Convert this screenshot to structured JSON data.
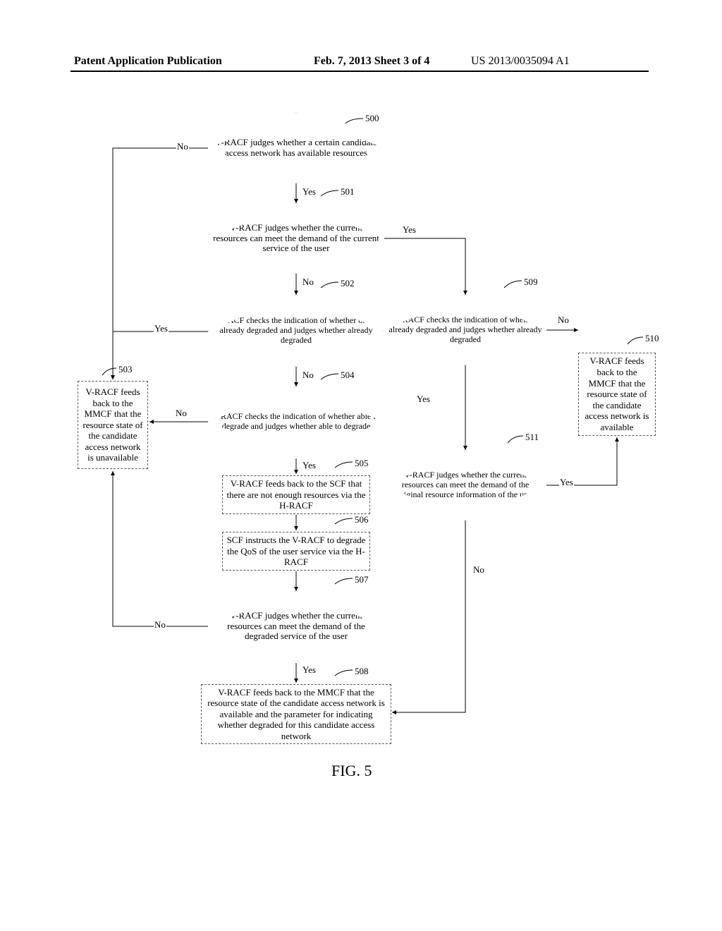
{
  "header": {
    "left": "Patent Application Publication",
    "center": "Feb. 7, 2013  Sheet 3 of 4",
    "right": "US 2013/0035094 A1"
  },
  "figure_caption": "FIG. 5",
  "refs": {
    "r500": "500",
    "r501": "501",
    "r502": "502",
    "r503": "503",
    "r504": "504",
    "r505": "505",
    "r506": "506",
    "r507": "507",
    "r508": "508",
    "r509": "509",
    "r510": "510",
    "r511": "511"
  },
  "labels": {
    "yes": "Yes",
    "no": "No"
  },
  "nodes": {
    "d500": "V-RACF judges whether a certain candidate access network has available resources",
    "d501": "V-RACF judges whether the current resources can meet the demand of the current service of the user",
    "d502": "V-RACF checks the indication of whether or not already degraded and judges whether already degraded",
    "b503": "V-RACF feeds back to the MMCF that the resource state of the candidate access network is unavailable",
    "d504": "V-RACF checks the indication of whether able to degrade and judges whether able to degrade",
    "b505": "V-RACF feeds back to the SCF that there are not enough resources via the H-RACF",
    "b506": "SCF instructs the V-RACF to degrade the QoS of the user service via the H-RACF",
    "d507": "V-RACF judges whether the current resources can meet the demand of the degraded service of the user",
    "b508": "V-RACF feeds back to the MMCF that the resource state of the candidate access network is available and the parameter for indicating whether degraded for this candidate access network",
    "d509": "V-RACF checks the indication of whether already degraded and judges whether already degraded",
    "b510": "V-RACF feeds back to the MMCF that the resource state of the candidate access network is available",
    "d511": "V-RACF judges whether the current resources can meet the demand of the original resource information of the user"
  }
}
